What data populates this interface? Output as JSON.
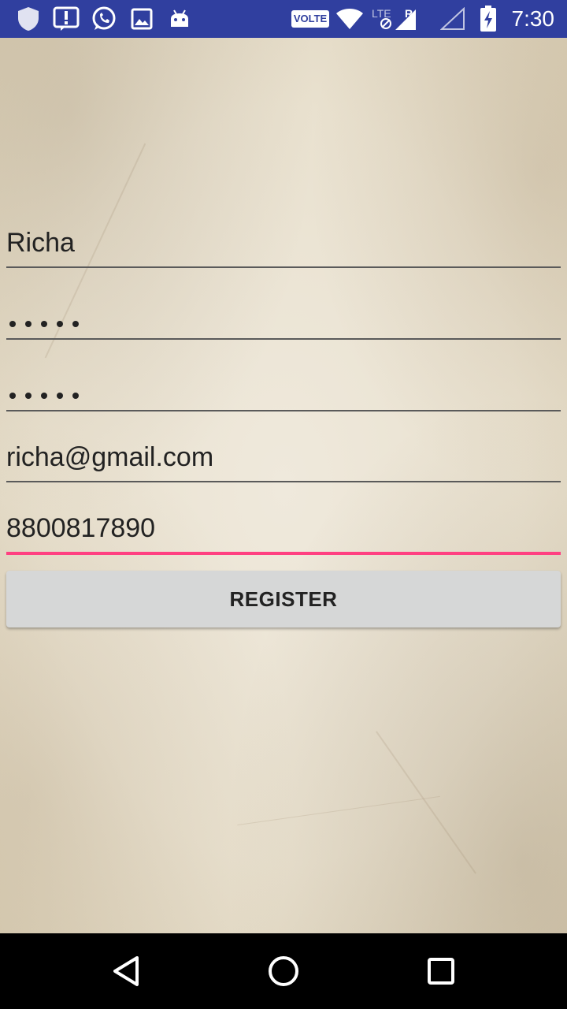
{
  "status_bar": {
    "time": "7:30",
    "volte_label": "VOLTE",
    "bg_color": "#303f9f",
    "icons": [
      "shield-icon",
      "alert-icon",
      "whatsapp-icon",
      "image-icon",
      "android-icon",
      "wifi-icon",
      "lte-icon",
      "signal-icon",
      "battery-icon"
    ]
  },
  "form": {
    "username": {
      "value": "Richa"
    },
    "password": {
      "dot_count": 5
    },
    "confirm_password": {
      "dot_count": 5
    },
    "email": {
      "value": "richa@gmail.com"
    },
    "phone": {
      "value": "8800817890",
      "focused": true,
      "accent_color": "#ff4081"
    },
    "register_label": "REGISTER"
  },
  "nav_bar": {
    "icons": [
      "back-icon",
      "home-icon",
      "recents-icon"
    ]
  }
}
